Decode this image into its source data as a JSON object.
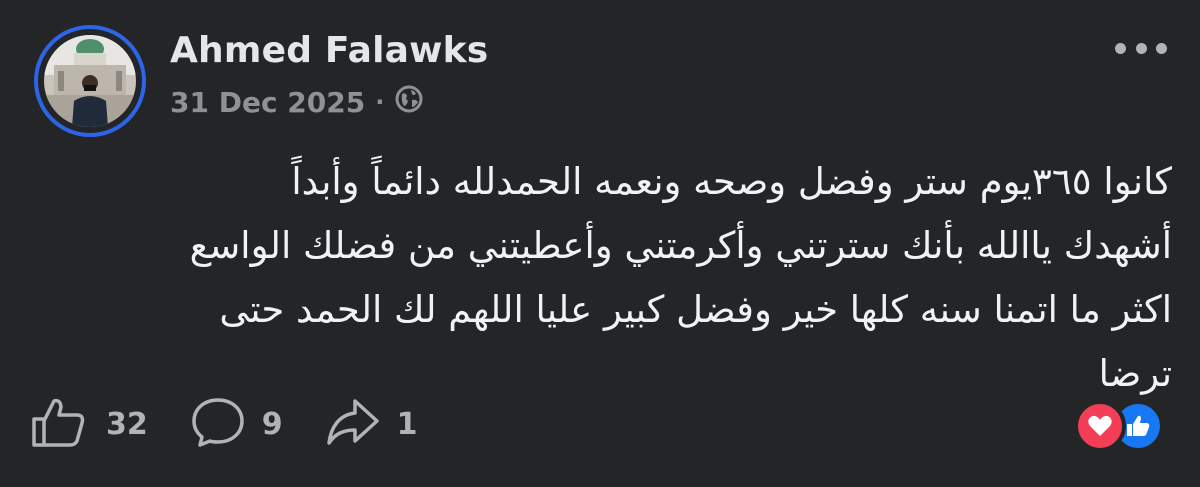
{
  "post": {
    "author": "Ahmed Falawks",
    "date": "31 Dec 2025",
    "separator": "·",
    "privacy_icon": "globe-icon",
    "text_lines": [
      "كانوا ٣٦٥يوم ستر وفضل وصحه ونعمه الحمدلله دائماً وأبداً",
      "أشهدك ياالله بأنك سترتني وأكرمتني وأعطيتني من فضلك الواسع",
      "اكثر ما اتمنا سنه كلها خير وفضل كبير عليا اللهم لك الحمد حتى",
      "ترضا"
    ]
  },
  "actions": {
    "like_count": "32",
    "comment_count": "9",
    "share_count": "1"
  },
  "reactions": [
    "heart-reaction-icon",
    "like-reaction-icon"
  ],
  "colors": {
    "background": "#242526",
    "avatar_ring": "#2d64e8",
    "text": "#e4e6eb",
    "muted": "#b0b3b8",
    "love": "#f33e58",
    "like": "#1877f2"
  }
}
